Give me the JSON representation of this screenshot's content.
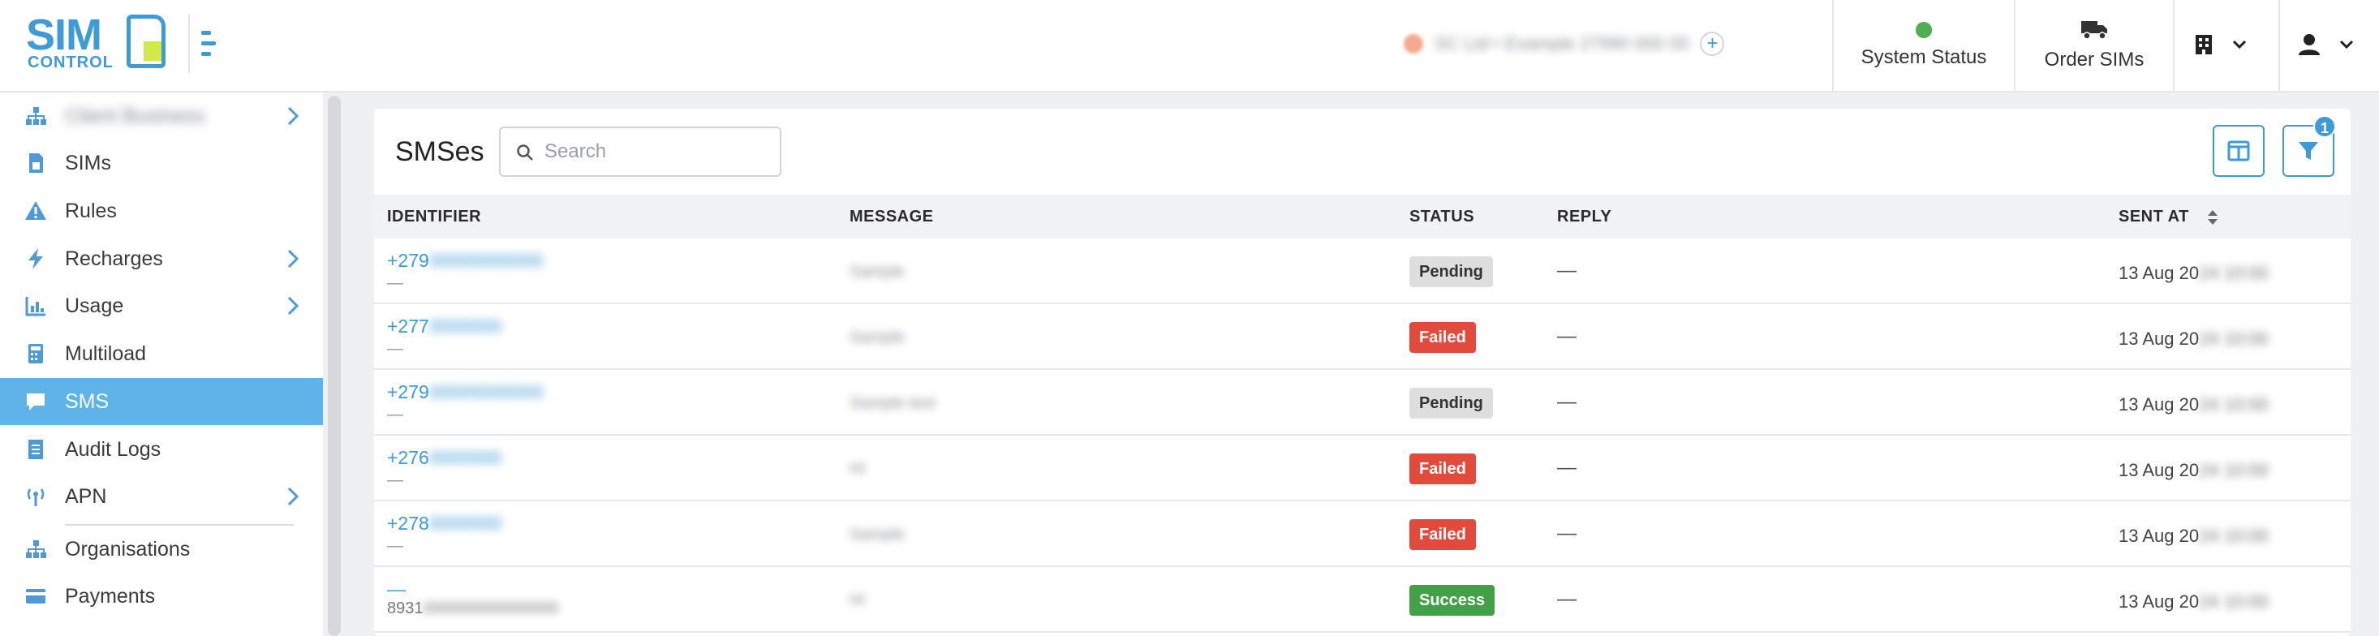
{
  "header": {
    "logo_main": "SIM",
    "logo_sub": "CONTROL",
    "account_text": "SC Ltd • Example 27990 000 00",
    "account_add": "+",
    "system_status_label": "System Status",
    "order_sims_label": "Order SIMs",
    "status_color": "#4caf50"
  },
  "sidebar": {
    "items": [
      {
        "label": "Client Business",
        "icon": "sitemap-icon",
        "chevron": true
      },
      {
        "label": "SIMs",
        "icon": "sim-card-icon",
        "chevron": false
      },
      {
        "label": "Rules",
        "icon": "warning-icon",
        "chevron": false
      },
      {
        "label": "Recharges",
        "icon": "bolt-icon",
        "chevron": true
      },
      {
        "label": "Usage",
        "icon": "chart-icon",
        "chevron": true
      },
      {
        "label": "Multiload",
        "icon": "calculator-icon",
        "chevron": false
      },
      {
        "label": "SMS",
        "icon": "comment-icon",
        "chevron": false
      },
      {
        "label": "Audit Logs",
        "icon": "document-icon",
        "chevron": false
      },
      {
        "label": "APN",
        "icon": "antenna-icon",
        "chevron": true
      },
      {
        "label": "Organisations",
        "icon": "sitemap-icon",
        "chevron": false
      },
      {
        "label": "Payments",
        "icon": "credit-card-icon",
        "chevron": false
      }
    ],
    "active_color": "#5eb3e8"
  },
  "main": {
    "title": "SMSes",
    "search_placeholder": "Search",
    "filter_count": "1",
    "columns": {
      "identifier": "IDENTIFIER",
      "message": "MESSAGE",
      "status": "STATUS",
      "reply": "REPLY",
      "sent_at": "SENT AT"
    },
    "rows": [
      {
        "id_prefix": "+279",
        "id_hidden": "00000000000",
        "sub": "—",
        "message": "Sample",
        "status": "Pending",
        "status_type": "pending",
        "reply": "—",
        "sent_prefix": "13 Aug 20",
        "sent_hidden": "24 10:00"
      },
      {
        "id_prefix": "+277",
        "id_hidden": "0000000",
        "sub": "—",
        "message": "Sample",
        "status": "Failed",
        "status_type": "failed",
        "reply": "—",
        "sent_prefix": "13 Aug 20",
        "sent_hidden": "24 10:00"
      },
      {
        "id_prefix": "+279",
        "id_hidden": "00000000000",
        "sub": "—",
        "message": "Sample text",
        "status": "Pending",
        "status_type": "pending",
        "reply": "—",
        "sent_prefix": "13 Aug 20",
        "sent_hidden": "24 10:00"
      },
      {
        "id_prefix": "+276",
        "id_hidden": "0000000",
        "sub": "—",
        "message": "Hi",
        "status": "Failed",
        "status_type": "failed",
        "reply": "—",
        "sent_prefix": "13 Aug 20",
        "sent_hidden": "24 10:00"
      },
      {
        "id_prefix": "+278",
        "id_hidden": "0000000",
        "sub": "—",
        "message": "Sample",
        "status": "Failed",
        "status_type": "failed",
        "reply": "—",
        "sent_prefix": "13 Aug 20",
        "sent_hidden": "24 10:00"
      },
      {
        "id_prefix": "—",
        "id_hidden": "",
        "sub": "8931",
        "sub_hidden": "000000000000000",
        "message": "Hi",
        "status": "Success",
        "status_type": "success",
        "reply": "—",
        "sent_prefix": "13 Aug 20",
        "sent_hidden": "24 10:00"
      }
    ]
  }
}
